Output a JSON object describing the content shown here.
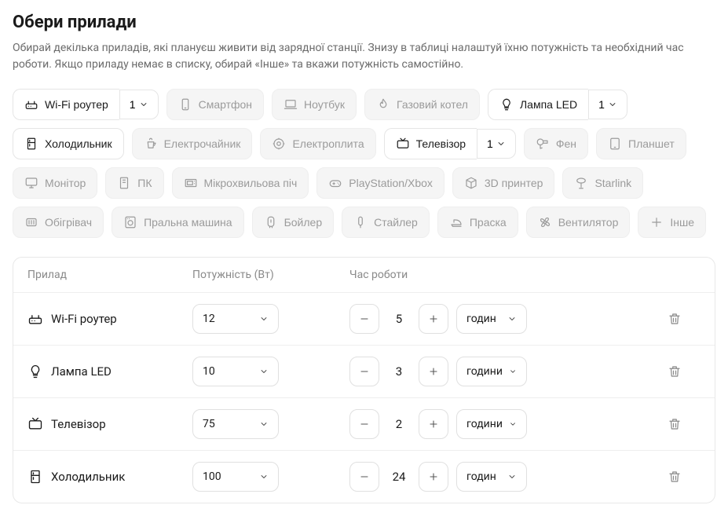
{
  "title": "Обери прилади",
  "subtitle": "Обирай декілька приладів, які плануєш живити від зарядної станції. Знизу в таблиці налаштуй їхню потужність та необхідний час роботи. Якщо приладу немає в списку, обирай «Інше» та вкажи потужність самостійно.",
  "chips": [
    {
      "label": "Wi-Fi роутер",
      "icon": "router",
      "selected": true,
      "count": "1"
    },
    {
      "label": "Смартфон",
      "icon": "smartphone",
      "selected": false
    },
    {
      "label": "Ноутбук",
      "icon": "laptop",
      "selected": false
    },
    {
      "label": "Газовий котел",
      "icon": "flame",
      "selected": false
    },
    {
      "label": "Лампа LED",
      "icon": "bulb",
      "selected": true,
      "count": "1"
    },
    {
      "label": "Холодильник",
      "icon": "fridge",
      "selected": true
    },
    {
      "label": "Електрочайник",
      "icon": "kettle",
      "selected": false
    },
    {
      "label": "Електроплита",
      "icon": "stove",
      "selected": false
    },
    {
      "label": "Телевізор",
      "icon": "tv",
      "selected": true,
      "count": "1"
    },
    {
      "label": "Фен",
      "icon": "hairdryer",
      "selected": false
    },
    {
      "label": "Планшет",
      "icon": "tablet",
      "selected": false
    },
    {
      "label": "Монітор",
      "icon": "monitor",
      "selected": false
    },
    {
      "label": "ПК",
      "icon": "pc",
      "selected": false
    },
    {
      "label": "Мікрохвильова піч",
      "icon": "microwave",
      "selected": false
    },
    {
      "label": "PlayStation/Xbox",
      "icon": "gamepad",
      "selected": false
    },
    {
      "label": "3D принтер",
      "icon": "printer3d",
      "selected": false
    },
    {
      "label": "Starlink",
      "icon": "starlink",
      "selected": false
    },
    {
      "label": "Обігрівач",
      "icon": "heater",
      "selected": false
    },
    {
      "label": "Пральна машина",
      "icon": "washer",
      "selected": false
    },
    {
      "label": "Бойлер",
      "icon": "boiler",
      "selected": false
    },
    {
      "label": "Стайлер",
      "icon": "styler",
      "selected": false
    },
    {
      "label": "Праска",
      "icon": "iron",
      "selected": false
    },
    {
      "label": "Вентилятор",
      "icon": "fan",
      "selected": false
    },
    {
      "label": "Інше",
      "icon": "plus",
      "selected": false
    }
  ],
  "table": {
    "headers": {
      "device": "Прилад",
      "power": "Потужність (Вт)",
      "time": "Час роботи"
    },
    "rows": [
      {
        "label": "Wi-Fi роутер",
        "icon": "router",
        "power": "12",
        "time": "5",
        "unit": "годин"
      },
      {
        "label": "Лампа LED",
        "icon": "bulb",
        "power": "10",
        "time": "3",
        "unit": "години"
      },
      {
        "label": "Телевізор",
        "icon": "tv",
        "power": "75",
        "time": "2",
        "unit": "години"
      },
      {
        "label": "Холодильник",
        "icon": "fridge",
        "power": "100",
        "time": "24",
        "unit": "годин"
      }
    ]
  }
}
